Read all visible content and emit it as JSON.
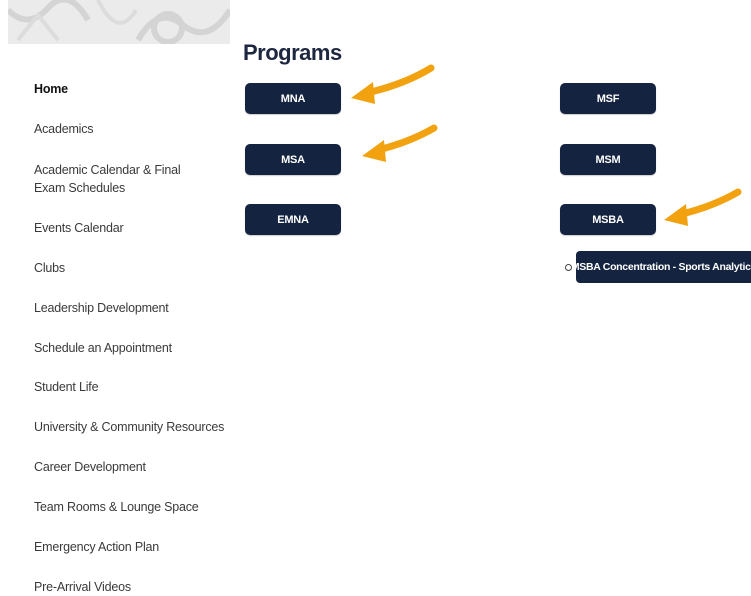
{
  "sidebar": {
    "items": [
      {
        "label": "Home"
      },
      {
        "label": "Academics"
      },
      {
        "label": "Academic Calendar & Final Exam Schedules"
      },
      {
        "label": "Events Calendar"
      },
      {
        "label": "Clubs"
      },
      {
        "label": "Leadership Development"
      },
      {
        "label": "Schedule an Appointment"
      },
      {
        "label": "Student Life"
      },
      {
        "label": "University & Community Resources"
      },
      {
        "label": "Career Development"
      },
      {
        "label": "Team Rooms & Lounge Space"
      },
      {
        "label": "Emergency Action Plan"
      },
      {
        "label": "Pre-Arrival Videos"
      }
    ]
  },
  "main": {
    "title": "Programs",
    "programs": [
      {
        "label": "MNA"
      },
      {
        "label": "MSF"
      },
      {
        "label": "MSA"
      },
      {
        "label": "MSM"
      },
      {
        "label": "EMNA"
      },
      {
        "label": "MSBA"
      }
    ],
    "sub_program": {
      "label": "MSBA Concentration - Sports Analytics"
    }
  },
  "colors": {
    "button_bg": "#14233f",
    "arrow": "#f2a20f",
    "banner_bg": "#e9e9e9"
  }
}
